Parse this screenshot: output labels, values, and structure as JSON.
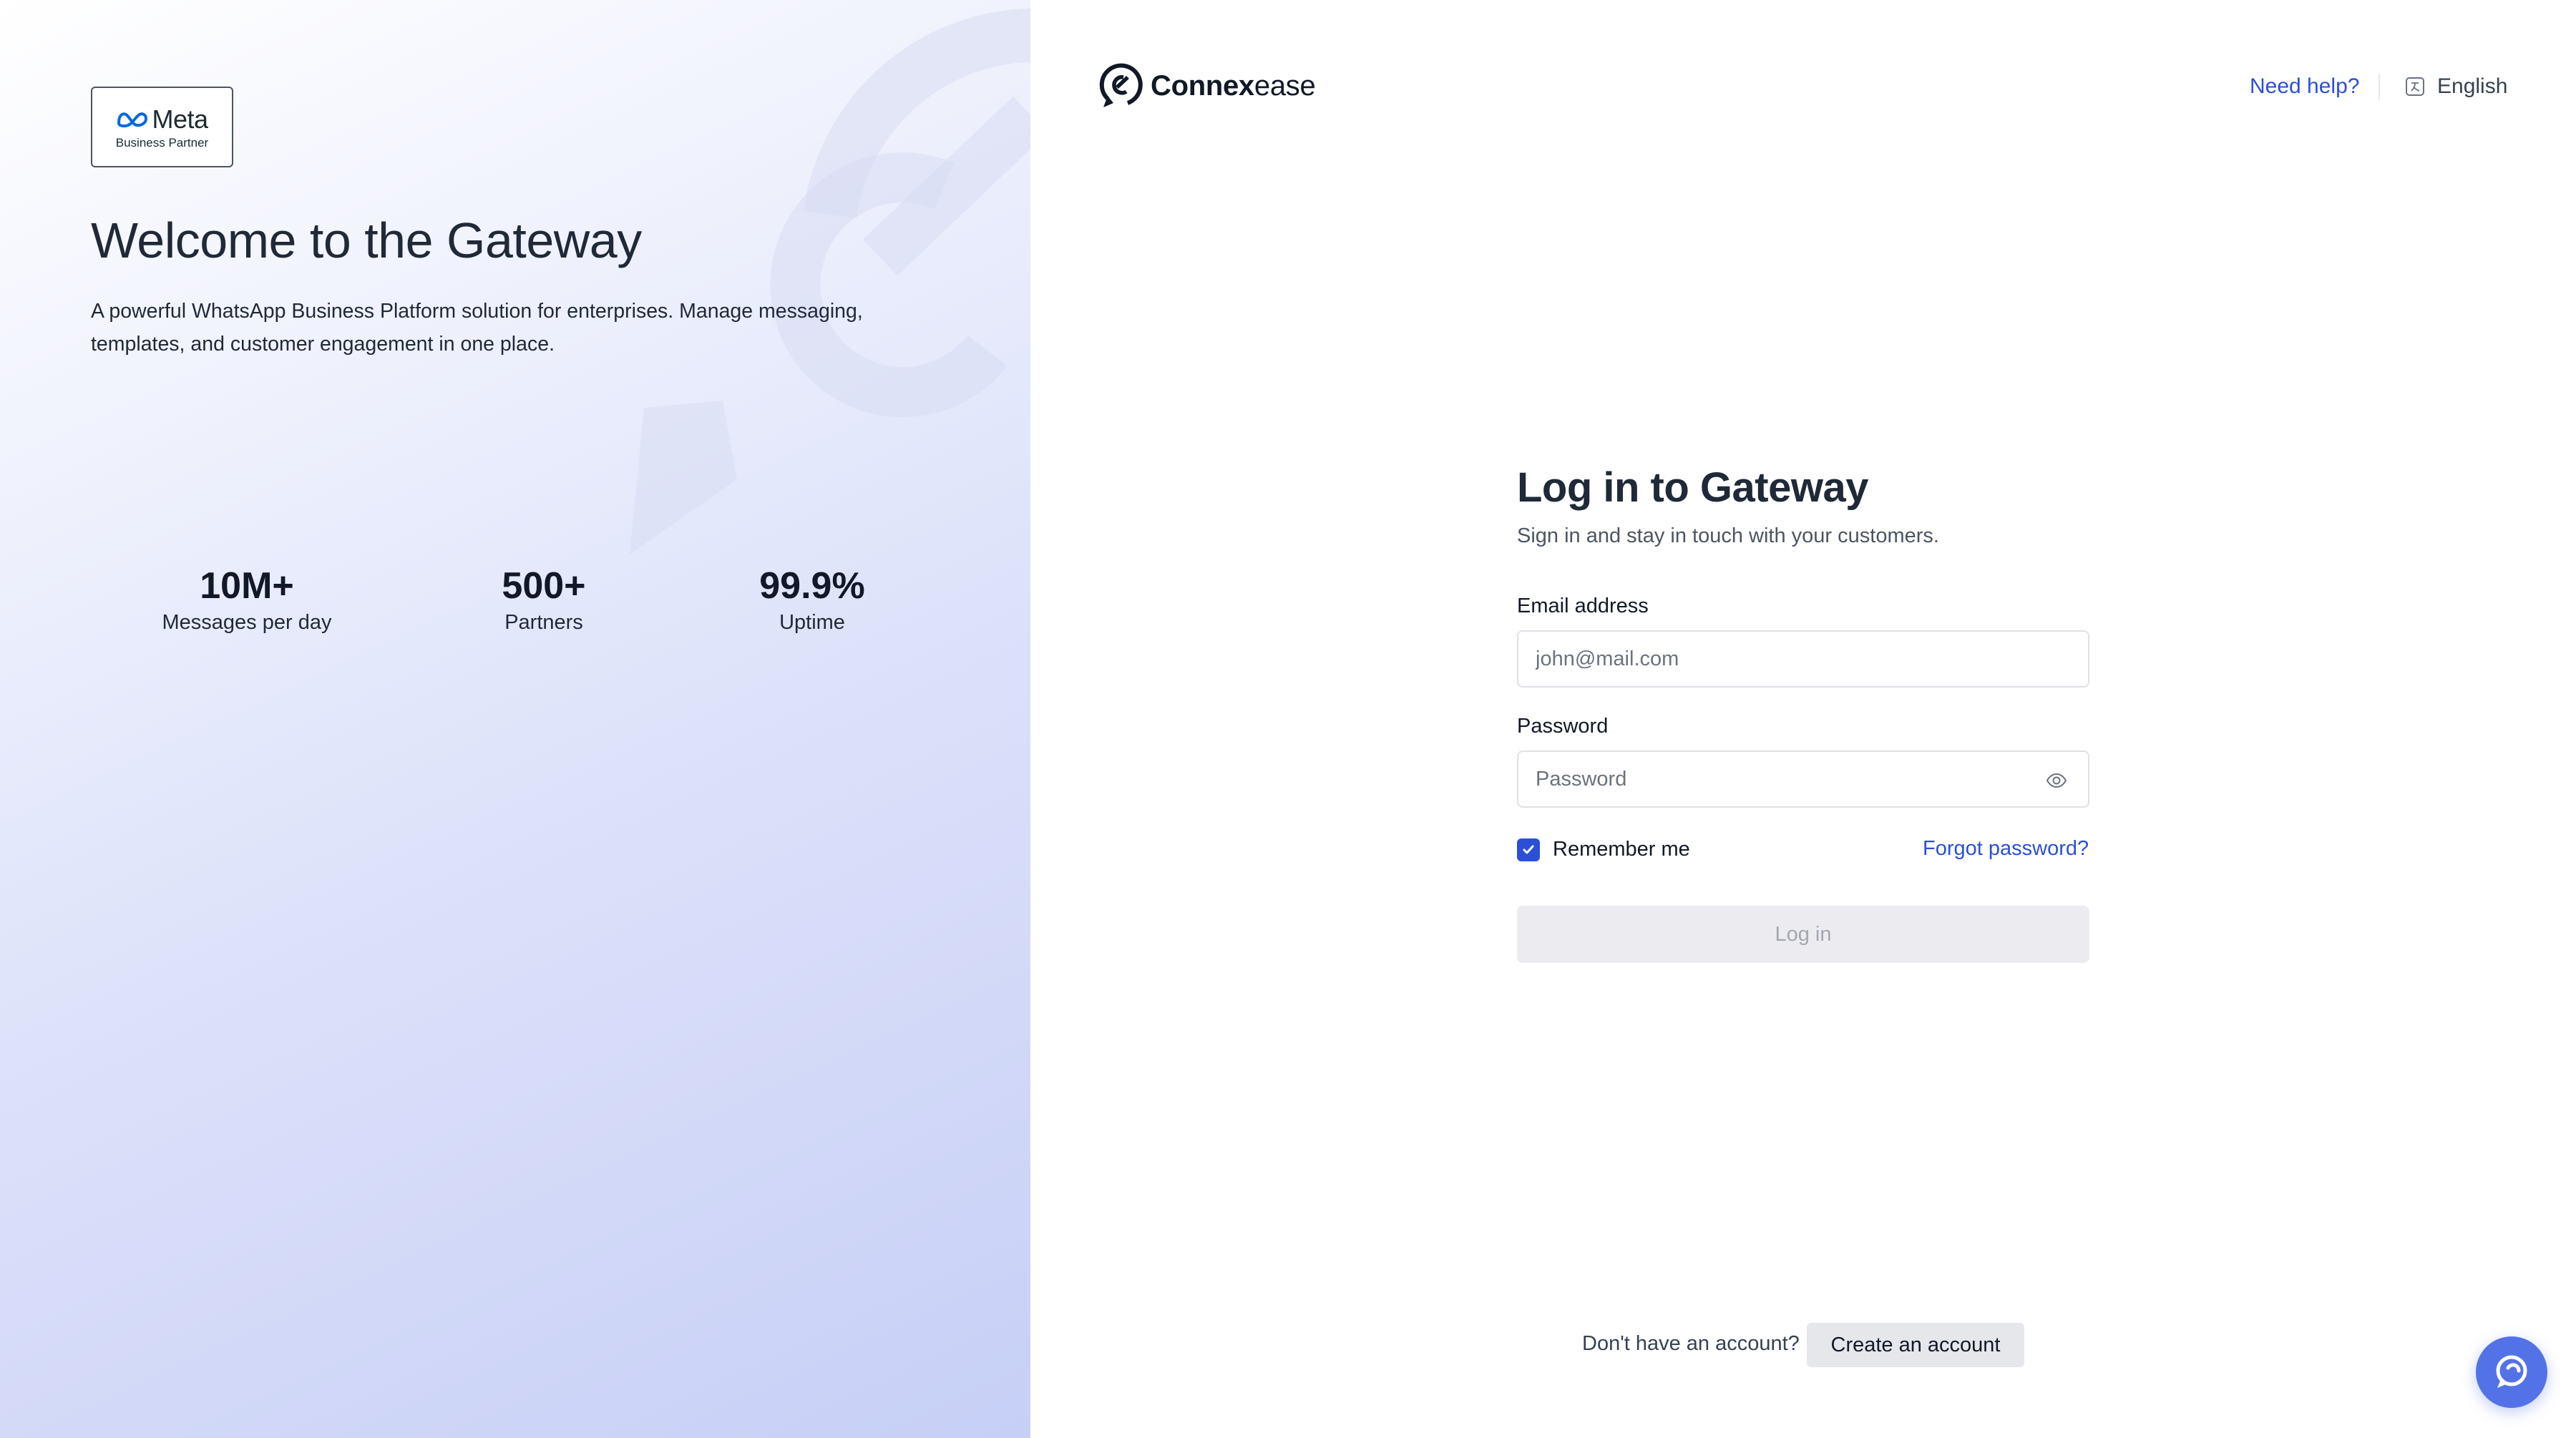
{
  "left": {
    "partner_badge": {
      "brand": "Meta",
      "subtitle": "Business Partner"
    },
    "title": "Welcome to the Gateway",
    "description": "A powerful WhatsApp Business Platform solution for enterprises. Manage messaging, templates, and customer engagement in one place.",
    "stats": [
      {
        "value": "10M+",
        "label": "Messages per day"
      },
      {
        "value": "500+",
        "label": "Partners"
      },
      {
        "value": "99.9%",
        "label": "Uptime"
      }
    ]
  },
  "header": {
    "brand_bold": "Connex",
    "brand_light": "ease",
    "help_link": "Need help?",
    "language": "English"
  },
  "login": {
    "title": "Log in to Gateway",
    "subtitle": "Sign in and stay in touch with your customers.",
    "email_label": "Email address",
    "email_placeholder": "john@mail.com",
    "email_value": "",
    "password_label": "Password",
    "password_placeholder": "Password",
    "password_value": "",
    "remember_label": "Remember me",
    "remember_checked": true,
    "forgot_link": "Forgot password?",
    "submit_label": "Log in"
  },
  "footer": {
    "prompt": "Don't have an account?",
    "create_label": "Create an account"
  },
  "icons": {
    "chat_widget": "chat-bubble-icon",
    "password_toggle": "eye-icon",
    "language": "translate-icon"
  },
  "colors": {
    "accent": "#2c4fd7",
    "chat_widget": "#5472e8",
    "disabled_button": "#ececf0"
  }
}
